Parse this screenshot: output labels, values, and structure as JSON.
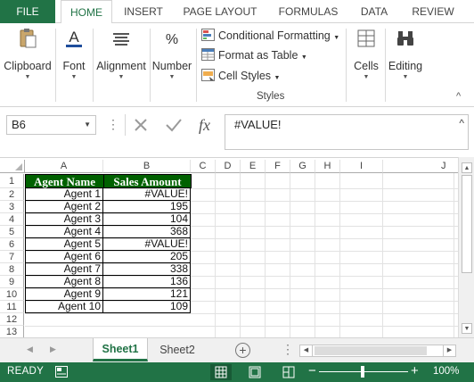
{
  "ribbon_tabs": {
    "file": "FILE",
    "home": "HOME",
    "insert": "INSERT",
    "page_layout": "PAGE LAYOUT",
    "formulas": "FORMULAS",
    "data": "DATA",
    "review": "REVIEW"
  },
  "ribbon_groups": {
    "clipboard": "Clipboard",
    "font": "Font",
    "alignment": "Alignment",
    "number": "Number",
    "cells": "Cells",
    "editing": "Editing",
    "styles": "Styles"
  },
  "styles_group": {
    "conditional_formatting": "Conditional Formatting",
    "format_as_table": "Format as Table",
    "cell_styles": "Cell Styles"
  },
  "formula_bar": {
    "name_box": "B6",
    "formula": "#VALUE!"
  },
  "columns": [
    "A",
    "B",
    "C",
    "D",
    "E",
    "F",
    "G",
    "H",
    "I",
    "J"
  ],
  "rows": [
    "1",
    "2",
    "3",
    "4",
    "5",
    "6",
    "7",
    "8",
    "9",
    "10",
    "11",
    "12",
    "13"
  ],
  "table": {
    "headers": [
      "Agent Name",
      "Sales Amount"
    ],
    "rows": [
      [
        "Agent 1",
        "#VALUE!"
      ],
      [
        "Agent 2",
        "195"
      ],
      [
        "Agent 3",
        "104"
      ],
      [
        "Agent 4",
        "368"
      ],
      [
        "Agent 5",
        "#VALUE!"
      ],
      [
        "Agent 6",
        "205"
      ],
      [
        "Agent 7",
        "338"
      ],
      [
        "Agent 8",
        "136"
      ],
      [
        "Agent 9",
        "121"
      ],
      [
        "Agent 10",
        "109"
      ]
    ]
  },
  "sheet_tabs": [
    "Sheet1",
    "Sheet2"
  ],
  "active_sheet": "Sheet1",
  "status": {
    "mode": "READY",
    "zoom": "100%"
  },
  "colors": {
    "excel_green": "#217346",
    "header_fill": "#006100"
  },
  "icons": [
    "paste-icon",
    "font-color-icon",
    "alignment-icon",
    "percent-icon",
    "conditional-formatting-icon",
    "format-as-table-icon",
    "cell-styles-icon",
    "cells-icon",
    "binoculars-icon",
    "cancel-icon",
    "enter-icon",
    "insert-function-icon",
    "add-sheet-icon",
    "macro-record-icon",
    "normal-view-icon",
    "page-layout-view-icon",
    "page-break-view-icon"
  ]
}
